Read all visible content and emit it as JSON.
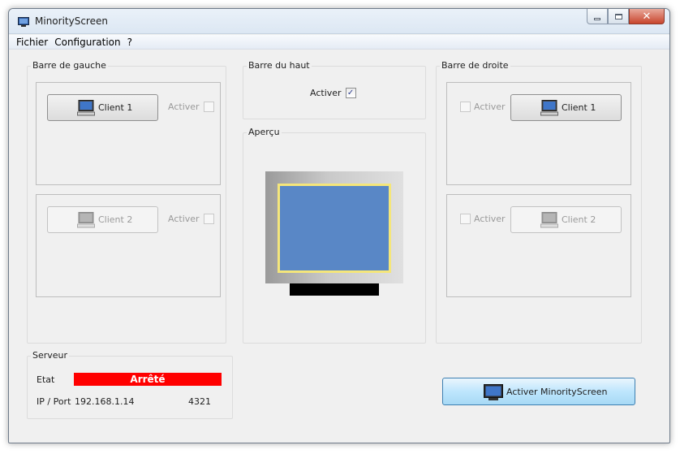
{
  "window": {
    "title": "MinorityScreen",
    "controls": {
      "minimize": "minimize",
      "maximize": "maximize",
      "close": "close"
    }
  },
  "menu": {
    "items": [
      "Fichier",
      "Configuration",
      "?"
    ]
  },
  "left_bar": {
    "title": "Barre de gauche",
    "clients": [
      {
        "label": "Client 1",
        "checkbox_label": "Activer",
        "enabled": true,
        "checked": false
      },
      {
        "label": "Client 2",
        "checkbox_label": "Activer",
        "enabled": false,
        "checked": false
      }
    ]
  },
  "top_bar": {
    "title": "Barre du haut",
    "checkbox_label": "Activer",
    "checked": true
  },
  "preview": {
    "title": "Aperçu"
  },
  "right_bar": {
    "title": "Barre de droite",
    "clients": [
      {
        "label": "Client 1",
        "checkbox_label": "Activer",
        "enabled": true,
        "checked": false
      },
      {
        "label": "Client 2",
        "checkbox_label": "Activer",
        "enabled": false,
        "checked": false
      }
    ]
  },
  "server": {
    "title": "Serveur",
    "state_label": "Etat",
    "state_value": "Arrêté",
    "ip_port_label": "IP / Port",
    "ip": "192.168.1.14",
    "port": "4321"
  },
  "actions": {
    "activate_label": "Activer MinorityScreen"
  },
  "colors": {
    "status_stopped": "#ff0000",
    "preview_screen": "#5987c6",
    "preview_border": "#f5e67a",
    "activate_button": "#bee6fd"
  }
}
